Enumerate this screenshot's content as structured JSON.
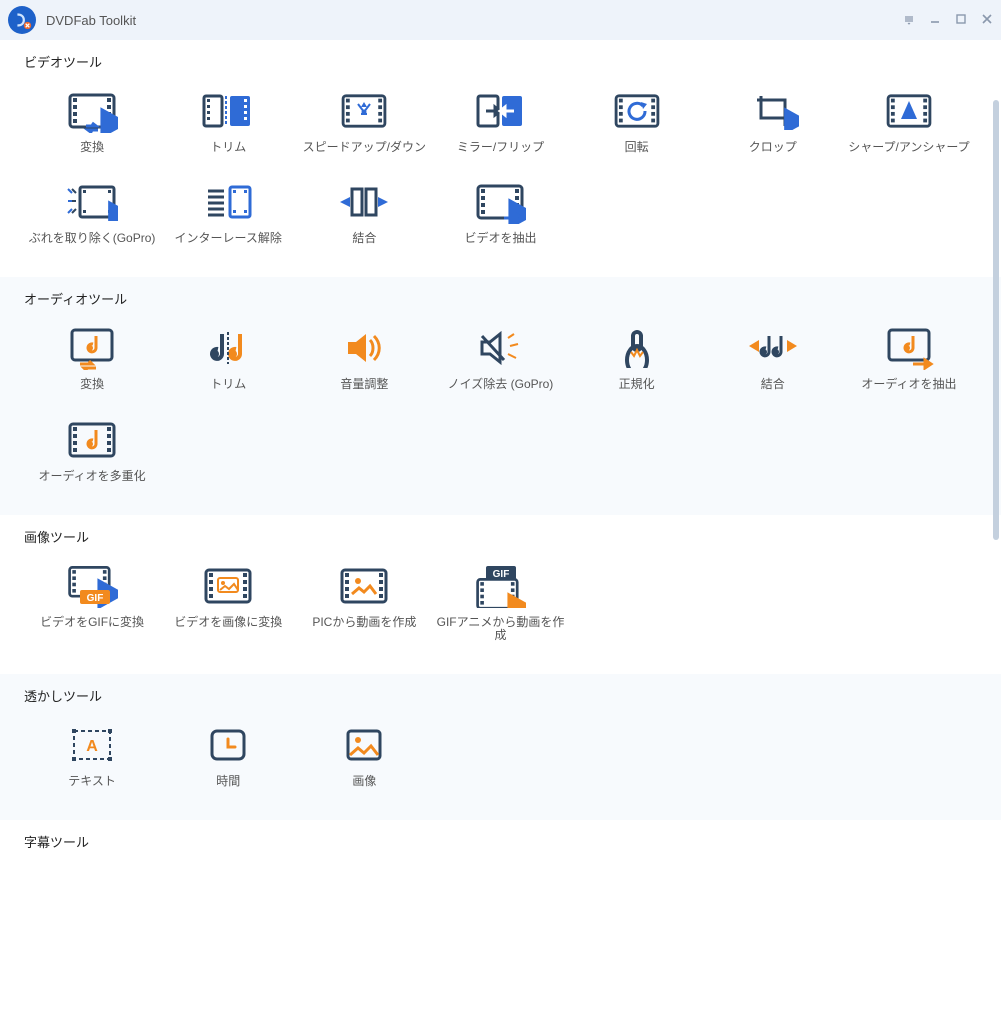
{
  "app_title": "DVDFab Toolkit",
  "sections": {
    "video": {
      "title": "ビデオツール"
    },
    "audio": {
      "title": "オーディオツール"
    },
    "image": {
      "title": "画像ツール"
    },
    "watermark": {
      "title": "透かしツール"
    },
    "subtitle": {
      "title": "字幕ツール"
    }
  },
  "tools": {
    "video_convert": {
      "label": "変換"
    },
    "video_trim": {
      "label": "トリム"
    },
    "video_speed": {
      "label": "スピードアップ/ダウン"
    },
    "video_mirror": {
      "label": "ミラー/フリップ"
    },
    "video_rotate": {
      "label": "回転"
    },
    "video_crop": {
      "label": "クロップ"
    },
    "video_sharpen": {
      "label": "シャープ/アンシャープ"
    },
    "video_stabilize": {
      "label": "ぶれを取り除く(GoPro)"
    },
    "video_deinterlace": {
      "label": "インターレース解除"
    },
    "video_merge": {
      "label": "結合"
    },
    "video_extract": {
      "label": "ビデオを抽出"
    },
    "audio_convert": {
      "label": "変換"
    },
    "audio_trim": {
      "label": "トリム"
    },
    "audio_volume": {
      "label": "音量調整"
    },
    "audio_denoise": {
      "label": "ノイズ除去 (GoPro)"
    },
    "audio_normalize": {
      "label": "正規化"
    },
    "audio_merge": {
      "label": "結合"
    },
    "audio_extract": {
      "label": "オーディオを抽出"
    },
    "audio_mux": {
      "label": "オーディオを多重化"
    },
    "img_video_to_gif": {
      "label": "ビデオをGIFに変換"
    },
    "img_video_to_img": {
      "label": "ビデオを画像に変換"
    },
    "img_pic_to_video": {
      "label": "PICから動画を作成"
    },
    "img_gif_to_video": {
      "label": "GIFアニメから動画を作成"
    },
    "wm_text": {
      "label": "テキスト"
    },
    "wm_time": {
      "label": "時間"
    },
    "wm_image": {
      "label": "画像"
    }
  },
  "colors": {
    "blue": "#2f6bd6",
    "navy": "#2f4660",
    "orange": "#f28a1e"
  }
}
